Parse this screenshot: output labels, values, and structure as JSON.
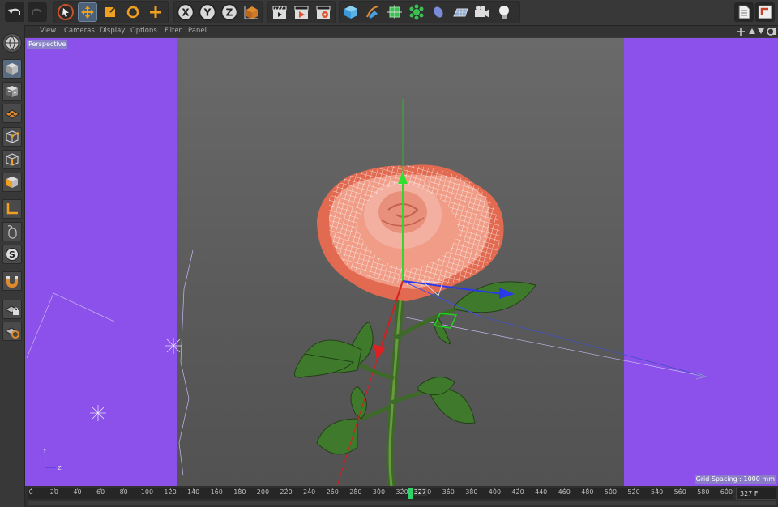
{
  "menu": [
    "View",
    "Cameras",
    "Display",
    "Options",
    "Filter",
    "Panel"
  ],
  "viewport": {
    "label": "Perspective",
    "grid_spacing": "Grid Spacing : 1000 mm"
  },
  "axes": {
    "y": "Y",
    "z": "Z"
  },
  "axis_buttons": [
    "X",
    "Y",
    "Z"
  ],
  "timeline": {
    "ticks": [
      "0",
      "20",
      "40",
      "60",
      "80",
      "100",
      "120",
      "140",
      "160",
      "180",
      "200",
      "220",
      "240",
      "260",
      "280",
      "300",
      "320",
      "340",
      "360",
      "380",
      "400",
      "420",
      "440",
      "460",
      "480",
      "500",
      "520",
      "540",
      "560",
      "580",
      "600"
    ],
    "current_frame": "327",
    "frame_field": "327 F"
  },
  "colors": {
    "viewport_bg": "#8b51ea",
    "accent": "#f0a020",
    "active_tool": "#4c6078"
  }
}
